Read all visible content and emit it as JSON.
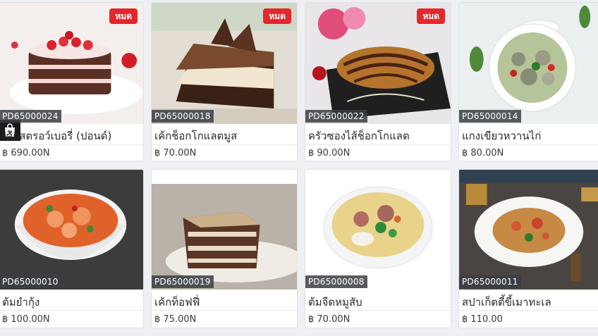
{
  "products": [
    {
      "code": "PD65000024",
      "name": "เค้กสตรอว์เบอรี่ (ปอนด์)",
      "price": "฿ 690.00N",
      "badge": "หมด",
      "icon": "strawberry-cake-image"
    },
    {
      "code": "PD65000018",
      "name": "เค้กช็อกโกแลตมูส",
      "price": "฿ 70.00N",
      "badge": "หมด",
      "icon": "chocolate-mousse-image"
    },
    {
      "code": "PD65000022",
      "name": "ครัวซองไส้ช็อกโกแลต",
      "price": "฿ 90.00N",
      "badge": "หมด",
      "icon": "croissant-image"
    },
    {
      "code": "PD65000014",
      "name": "แกงเขียวหวานไก่",
      "price": "฿ 80.00N",
      "badge": "",
      "icon": "green-curry-image"
    },
    {
      "code": "PD65000010",
      "name": "ต้มยำกุ้ง",
      "price": "฿ 100.00N",
      "badge": "",
      "icon": "tom-yum-image"
    },
    {
      "code": "PD65000019",
      "name": "เค้กท็อฟฟี่",
      "price": "฿ 75.00N",
      "badge": "",
      "icon": "toffee-cake-image"
    },
    {
      "code": "PD65000008",
      "name": "ต้มจืดหมูสับ",
      "price": "฿ 70.00N",
      "badge": "",
      "icon": "clear-soup-image"
    },
    {
      "code": "PD65000011",
      "name": "สปาเก็ตตี้ขี้เมาทะเล",
      "price": "฿ 110.00",
      "badge": "",
      "icon": "spaghetti-image"
    }
  ],
  "colors": {
    "badge": "#e4262d",
    "code_bg": "#3a3e44",
    "page_bg": "#eef0f3"
  },
  "icons": {
    "bag": "shopping-bag-discount-icon"
  }
}
